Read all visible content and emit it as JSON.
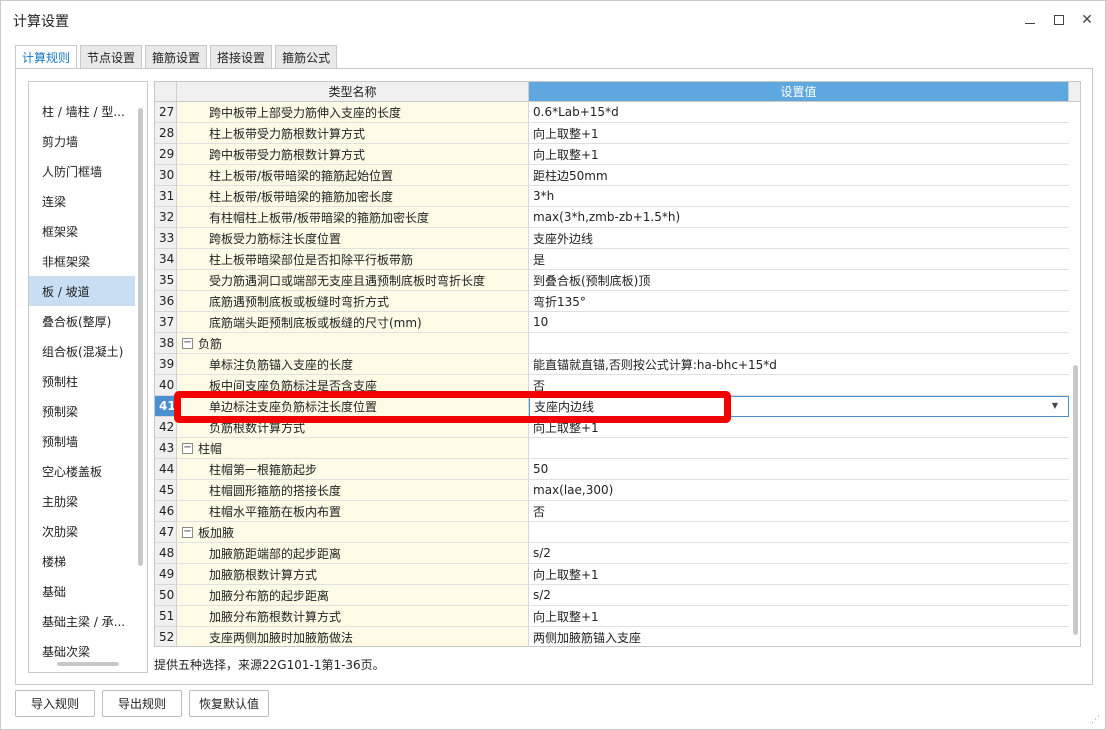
{
  "window": {
    "title": "计算设置",
    "minimize_icon": "minimize-icon",
    "maximize_icon": "maximize-icon",
    "close_glyph": "✕"
  },
  "tabs": [
    {
      "label": "计算规则",
      "active": true
    },
    {
      "label": "节点设置",
      "active": false
    },
    {
      "label": "箍筋设置",
      "active": false
    },
    {
      "label": "搭接设置",
      "active": false
    },
    {
      "label": "箍筋公式",
      "active": false
    }
  ],
  "sidebar": {
    "items": [
      {
        "label": "柱 / 墙柱 / 型..."
      },
      {
        "label": "剪力墙"
      },
      {
        "label": "人防门框墙"
      },
      {
        "label": "连梁"
      },
      {
        "label": "框架梁"
      },
      {
        "label": "非框架梁"
      },
      {
        "label": "板 / 坡道",
        "selected": true
      },
      {
        "label": "叠合板(整厚)"
      },
      {
        "label": "组合板(混凝土)"
      },
      {
        "label": "预制柱"
      },
      {
        "label": "预制梁"
      },
      {
        "label": "预制墙"
      },
      {
        "label": "空心楼盖板"
      },
      {
        "label": "主肋梁"
      },
      {
        "label": "次肋梁"
      },
      {
        "label": "楼梯"
      },
      {
        "label": "基础"
      },
      {
        "label": "基础主梁 / 承..."
      },
      {
        "label": "基础次梁"
      }
    ]
  },
  "grid": {
    "headers": {
      "name": "类型名称",
      "value": "设置值"
    },
    "rows": [
      {
        "num": "27",
        "name": "跨中板带上部受力筋伸入支座的长度",
        "value": "0.6*Lab+15*d"
      },
      {
        "num": "28",
        "name": "柱上板带受力筋根数计算方式",
        "value": "向上取整+1"
      },
      {
        "num": "29",
        "name": "跨中板带受力筋根数计算方式",
        "value": "向上取整+1"
      },
      {
        "num": "30",
        "name": "柱上板带/板带暗梁的箍筋起始位置",
        "value": "距柱边50mm"
      },
      {
        "num": "31",
        "name": "柱上板带/板带暗梁的箍筋加密长度",
        "value": "3*h"
      },
      {
        "num": "32",
        "name": "有柱帽柱上板带/板带暗梁的箍筋加密长度",
        "value": "max(3*h,zmb-zb+1.5*h)"
      },
      {
        "num": "33",
        "name": "跨板受力筋标注长度位置",
        "value": "支座外边线"
      },
      {
        "num": "34",
        "name": "柱上板带暗梁部位是否扣除平行板带筋",
        "value": "是"
      },
      {
        "num": "35",
        "name": "受力筋遇洞口或端部无支座且遇预制底板时弯折长度",
        "value": "到叠合板(预制底板)顶"
      },
      {
        "num": "36",
        "name": "底筋遇预制底板或板缝时弯折方式",
        "value": "弯折135°"
      },
      {
        "num": "37",
        "name": "底筋端头距预制底板或板缝的尺寸(mm)",
        "value": "10"
      },
      {
        "num": "38",
        "name": "负筋",
        "value": "",
        "group": true
      },
      {
        "num": "39",
        "name": "单标注负筋锚入支座的长度",
        "value": "能直锚就直锚,否则按公式计算:ha-bhc+15*d"
      },
      {
        "num": "40",
        "name": "板中间支座负筋标注是否含支座",
        "value": "否"
      },
      {
        "num": "41",
        "name": "单边标注支座负筋标注长度位置",
        "value": "支座内边线",
        "current": true
      },
      {
        "num": "42",
        "name": "负筋根数计算方式",
        "value": "向上取整+1"
      },
      {
        "num": "43",
        "name": "柱帽",
        "value": "",
        "group": true
      },
      {
        "num": "44",
        "name": "柱帽第一根箍筋起步",
        "value": "50"
      },
      {
        "num": "45",
        "name": "柱帽圆形箍筋的搭接长度",
        "value": "max(lae,300)"
      },
      {
        "num": "46",
        "name": "柱帽水平箍筋在板内布置",
        "value": "否"
      },
      {
        "num": "47",
        "name": "板加腋",
        "value": "",
        "group": true
      },
      {
        "num": "48",
        "name": "加腋筋距端部的起步距离",
        "value": "s/2"
      },
      {
        "num": "49",
        "name": "加腋筋根数计算方式",
        "value": "向上取整+1"
      },
      {
        "num": "50",
        "name": "加腋分布筋的起步距离",
        "value": "s/2"
      },
      {
        "num": "51",
        "name": "加腋分布筋根数计算方式",
        "value": "向上取整+1"
      },
      {
        "num": "52",
        "name": "支座两侧加腋时加腋筋做法",
        "value": "两侧加腋筋锚入支座"
      }
    ]
  },
  "hint": "提供五种选择，来源22G101-1第1-36页。",
  "buttons": {
    "import": "导入规则",
    "export": "导出规则",
    "reset": "恢复默认值"
  },
  "colors": {
    "highlight": "#f20000",
    "header_value_bg": "#5fa8df",
    "selected_side": "#c9def2",
    "name_cell_bg": "#fdfbe6"
  }
}
